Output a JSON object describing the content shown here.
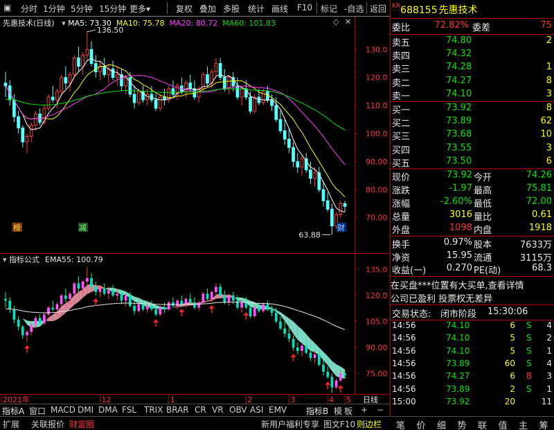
{
  "toolbar": {
    "items": [
      "分时",
      "1分钟",
      "5分钟",
      "15分钟",
      "更多",
      "复权",
      "叠加",
      "多股",
      "统计",
      "画线",
      "F10",
      "标记",
      "-自选",
      "返回"
    ]
  },
  "main_chart": {
    "title": "先惠技术(日线)",
    "ma5": "MA5: 73.30",
    "ma10": "MA10: 75.78",
    "ma20": "MA20: 80.72",
    "ma60": "MA60: 101.83",
    "high_label": "136.50",
    "low_label": "63.88",
    "badge_left": "榜",
    "badge_mid": "减",
    "badge_right": "财",
    "y_ticks": [
      "130.0",
      "120.0",
      "110.0",
      "100.0",
      "90.00",
      "80.00",
      "70.00"
    ]
  },
  "sub_chart": {
    "title": "指标公式",
    "ema": "EMA55: 100.79",
    "y_ticks": [
      "135.0",
      "120.0",
      "105.0",
      "90.00",
      "75.00"
    ]
  },
  "date_axis": {
    "labels": [
      "2021年",
      "12",
      "1",
      "2",
      "3",
      "4",
      "5"
    ],
    "period": "日线"
  },
  "indicator_tabs": [
    "指标A",
    "窗口",
    "MACD",
    "DMI",
    "DMA",
    "FSL",
    "TRIX",
    "BRAR",
    "CR",
    "VR",
    "OBV",
    "ASI",
    "EMV",
    "指标B",
    "模",
    "板",
    "+",
    "−"
  ],
  "bottom_tabs": {
    "left": [
      "扩展",
      "关联报价",
      "财富圈"
    ],
    "right": [
      "新用户福利专享",
      "图文F10",
      "则边栏"
    ]
  },
  "quote": {
    "market": "KR",
    "code": "688155",
    "name": "先惠技术",
    "weibi_label": "委比",
    "weibi": "72.82%",
    "weicha_label": "委差",
    "weicha": "75",
    "asks": [
      {
        "label": "卖五",
        "price": "74.80",
        "vol": "2"
      },
      {
        "label": "卖四",
        "price": "74.32",
        "vol": ""
      },
      {
        "label": "卖三",
        "price": "74.28",
        "vol": "1"
      },
      {
        "label": "卖二",
        "price": "74.27",
        "vol": "8"
      },
      {
        "label": "卖一",
        "price": "74.10",
        "vol": "3"
      }
    ],
    "bids": [
      {
        "label": "买一",
        "price": "73.92",
        "vol": "8"
      },
      {
        "label": "买二",
        "price": "73.89",
        "vol": "62"
      },
      {
        "label": "买三",
        "price": "73.68",
        "vol": "10"
      },
      {
        "label": "买四",
        "price": "73.55",
        "vol": "3"
      },
      {
        "label": "买五",
        "price": "73.50",
        "vol": "6"
      }
    ],
    "stats": [
      {
        "l1": "现价",
        "v1": "73.92",
        "l2": "今开",
        "v2": "74.26"
      },
      {
        "l1": "涨跌",
        "v1": "-1.97",
        "l2": "最高",
        "v2": "75.81"
      },
      {
        "l1": "涨幅",
        "v1": "-2.60%",
        "l2": "最低",
        "v2": "72.00"
      },
      {
        "l1": "总量",
        "v1": "3016",
        "l2": "量比",
        "v2": "0.61"
      },
      {
        "l1": "外盘",
        "v1": "1098",
        "l2": "内盘",
        "v2": "1918"
      }
    ],
    "fundamentals": [
      {
        "l1": "换手",
        "v1": "0.97%",
        "l2": "股本",
        "v2": "7633万"
      },
      {
        "l1": "净资",
        "v1": "15.95",
        "l2": "流通",
        "v2": "3115万"
      },
      {
        "l1": "收益(一)",
        "v1": "0.270",
        "l2": "PE(动)",
        "v2": "68.3"
      }
    ],
    "news1": "在买盘***位置有大买单,查看详情",
    "news2": "公司已盈利 投票权无差异",
    "status_label": "交易状态:",
    "status": "闭市阶段",
    "status_time": "15:30:06",
    "ticks": [
      {
        "t": "14:56",
        "p": "74.10",
        "v": "6",
        "d": "S",
        "n": "4"
      },
      {
        "t": "14:56",
        "p": "74.10",
        "v": "5",
        "d": "S",
        "n": "2"
      },
      {
        "t": "14:56",
        "p": "74.10",
        "v": "5",
        "d": "S",
        "n": "1"
      },
      {
        "t": "14:56",
        "p": "73.89",
        "v": "60",
        "d": "S",
        "n": "4"
      },
      {
        "t": "14:56",
        "p": "74.27",
        "v": "6",
        "d": "B",
        "n": "3"
      },
      {
        "t": "14:56",
        "p": "73.89",
        "v": "2",
        "d": "S",
        "n": "1"
      },
      {
        "t": "15:00",
        "p": "73.92",
        "v": "20",
        "d": "",
        "n": "11"
      }
    ]
  },
  "right_tabs": [
    "笔",
    "价",
    "细",
    "势",
    "联",
    "值",
    "主",
    "筹"
  ],
  "chart_data": {
    "type": "candlestick",
    "title": "先惠技术(日线)",
    "ylim": [
      62,
      138
    ],
    "candles": [
      [
        118,
        122,
        113,
        117
      ],
      [
        117,
        119,
        110,
        112
      ],
      [
        112,
        114,
        104,
        106
      ],
      [
        106,
        108,
        100,
        102
      ],
      [
        102,
        103,
        95,
        97
      ],
      [
        97,
        100,
        93,
        99
      ],
      [
        99,
        104,
        97,
        103
      ],
      [
        103,
        108,
        101,
        107
      ],
      [
        107,
        109,
        103,
        104
      ],
      [
        104,
        110,
        103,
        109
      ],
      [
        109,
        114,
        108,
        113
      ],
      [
        113,
        117,
        111,
        112
      ],
      [
        112,
        116,
        109,
        115
      ],
      [
        115,
        121,
        114,
        120
      ],
      [
        120,
        124,
        116,
        118
      ],
      [
        118,
        122,
        115,
        121
      ],
      [
        121,
        128,
        120,
        127
      ],
      [
        127,
        131,
        122,
        124
      ],
      [
        124,
        129,
        121,
        128
      ],
      [
        128,
        136.5,
        126,
        130
      ],
      [
        130,
        133,
        124,
        125
      ],
      [
        125,
        128,
        120,
        122
      ],
      [
        122,
        126,
        119,
        124
      ],
      [
        124,
        127,
        120,
        121
      ],
      [
        121,
        125,
        118,
        123
      ],
      [
        123,
        126,
        119,
        120
      ],
      [
        120,
        124,
        117,
        121
      ],
      [
        121,
        123,
        115,
        117
      ],
      [
        117,
        121,
        114,
        120
      ],
      [
        120,
        122,
        113,
        114
      ],
      [
        114,
        117,
        109,
        111
      ],
      [
        111,
        116,
        110,
        115
      ],
      [
        115,
        117,
        111,
        112
      ],
      [
        112,
        116,
        110,
        114
      ],
      [
        114,
        117,
        111,
        112
      ],
      [
        112,
        114,
        108,
        109
      ],
      [
        109,
        114,
        108,
        113
      ],
      [
        113,
        116,
        110,
        112
      ],
      [
        112,
        117,
        111,
        116
      ],
      [
        116,
        119,
        113,
        114
      ],
      [
        114,
        118,
        112,
        117
      ],
      [
        117,
        120,
        114,
        115
      ],
      [
        115,
        119,
        113,
        118
      ],
      [
        118,
        121,
        115,
        116
      ],
      [
        116,
        119,
        112,
        113
      ],
      [
        113,
        117,
        111,
        116
      ],
      [
        116,
        122,
        115,
        121
      ],
      [
        121,
        124,
        117,
        118
      ],
      [
        118,
        123,
        116,
        122
      ],
      [
        122,
        127,
        120,
        125
      ],
      [
        125,
        127,
        119,
        120
      ],
      [
        120,
        123,
        115,
        116
      ],
      [
        116,
        121,
        114,
        120
      ],
      [
        120,
        122,
        115,
        117
      ],
      [
        117,
        120,
        112,
        113
      ],
      [
        113,
        117,
        110,
        116
      ],
      [
        116,
        119,
        112,
        113
      ],
      [
        113,
        115,
        107,
        108
      ],
      [
        108,
        114,
        107,
        113
      ],
      [
        113,
        116,
        110,
        111
      ],
      [
        111,
        116,
        110,
        115
      ],
      [
        115,
        117,
        111,
        112
      ],
      [
        112,
        114,
        108,
        110
      ],
      [
        110,
        113,
        104,
        105
      ],
      [
        105,
        108,
        100,
        101
      ],
      [
        101,
        105,
        96,
        98
      ],
      [
        98,
        102,
        93,
        95
      ],
      [
        95,
        97,
        88,
        90
      ],
      [
        90,
        93,
        86,
        88
      ],
      [
        88,
        92,
        85,
        91
      ],
      [
        91,
        93,
        86,
        87
      ],
      [
        87,
        90,
        82,
        84
      ],
      [
        84,
        88,
        81,
        86
      ],
      [
        86,
        88,
        79,
        80
      ],
      [
        80,
        83,
        74,
        76
      ],
      [
        76,
        79,
        72,
        73
      ],
      [
        73,
        75,
        63.88,
        67
      ],
      [
        67,
        72,
        66,
        71
      ],
      [
        71,
        76,
        70,
        75
      ],
      [
        75,
        76,
        72,
        74
      ]
    ],
    "ma5_last": 73.3,
    "ma10_last": 75.78,
    "ma20_last": 80.72,
    "ma60_last": 101.83,
    "ema55_last": 100.79,
    "x_labels": [
      "2021年",
      "12",
      "1",
      "2",
      "3",
      "4",
      "5"
    ]
  }
}
